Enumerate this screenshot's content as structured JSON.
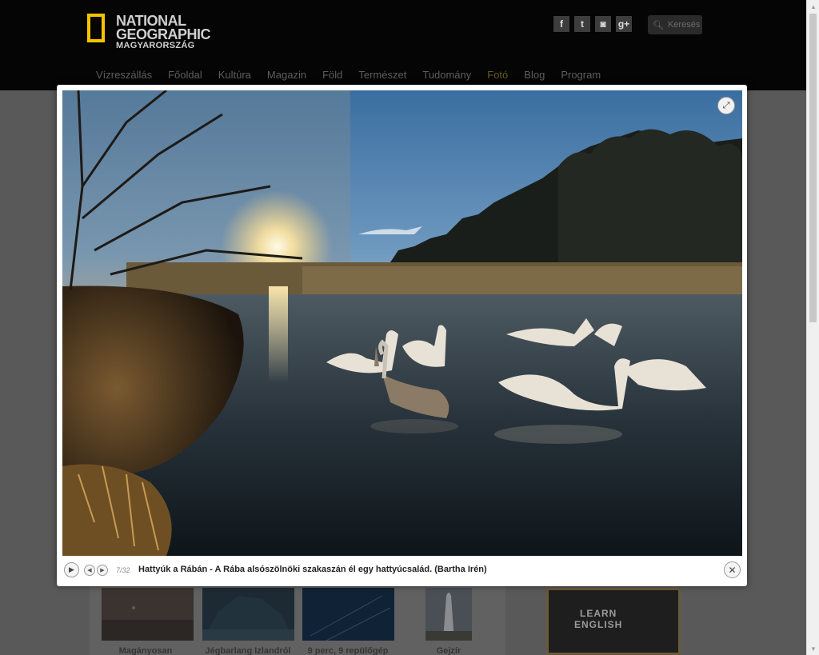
{
  "site": {
    "logo": {
      "line1": "NATIONAL",
      "line2": "GEOGRAPHIC",
      "line3": "MAGYARORSZÁG"
    },
    "social": [
      {
        "icon": "facebook-icon",
        "glyph": "f"
      },
      {
        "icon": "twitter-icon",
        "glyph": "t"
      },
      {
        "icon": "instagram-icon",
        "glyph": "◙"
      },
      {
        "icon": "google-plus-icon",
        "glyph": "g+"
      }
    ],
    "search": {
      "placeholder": "Keresés"
    },
    "nav": [
      "Vízreszállás",
      "Főoldal",
      "Kultúra",
      "Magazin",
      "Föld",
      "Természet",
      "Tudomány",
      "Fotó",
      "Blog",
      "Program"
    ],
    "nav_active": "Fotó"
  },
  "background": {
    "thumb_captions": [
      "Magányosan",
      "Jégbarlang Izlandról",
      "9 perc, 9 repülőgép",
      "Gejzír"
    ],
    "ad_lines": [
      "LEARN",
      "ENGLISH"
    ]
  },
  "lightbox": {
    "counter": "7/32",
    "caption": "Hattyúk a Rábán - A Rába alsószölnöki szakaszán él egy hattyúcsalád. (Bartha Irén)",
    "play_glyph": "▶",
    "prev_glyph": "◀",
    "next_glyph": "▶",
    "close_glyph": "✕",
    "expand_glyph": "⤢"
  },
  "colors": {
    "accent": "#f5c400",
    "overlay": "#595959",
    "modal": "#ffffff"
  }
}
